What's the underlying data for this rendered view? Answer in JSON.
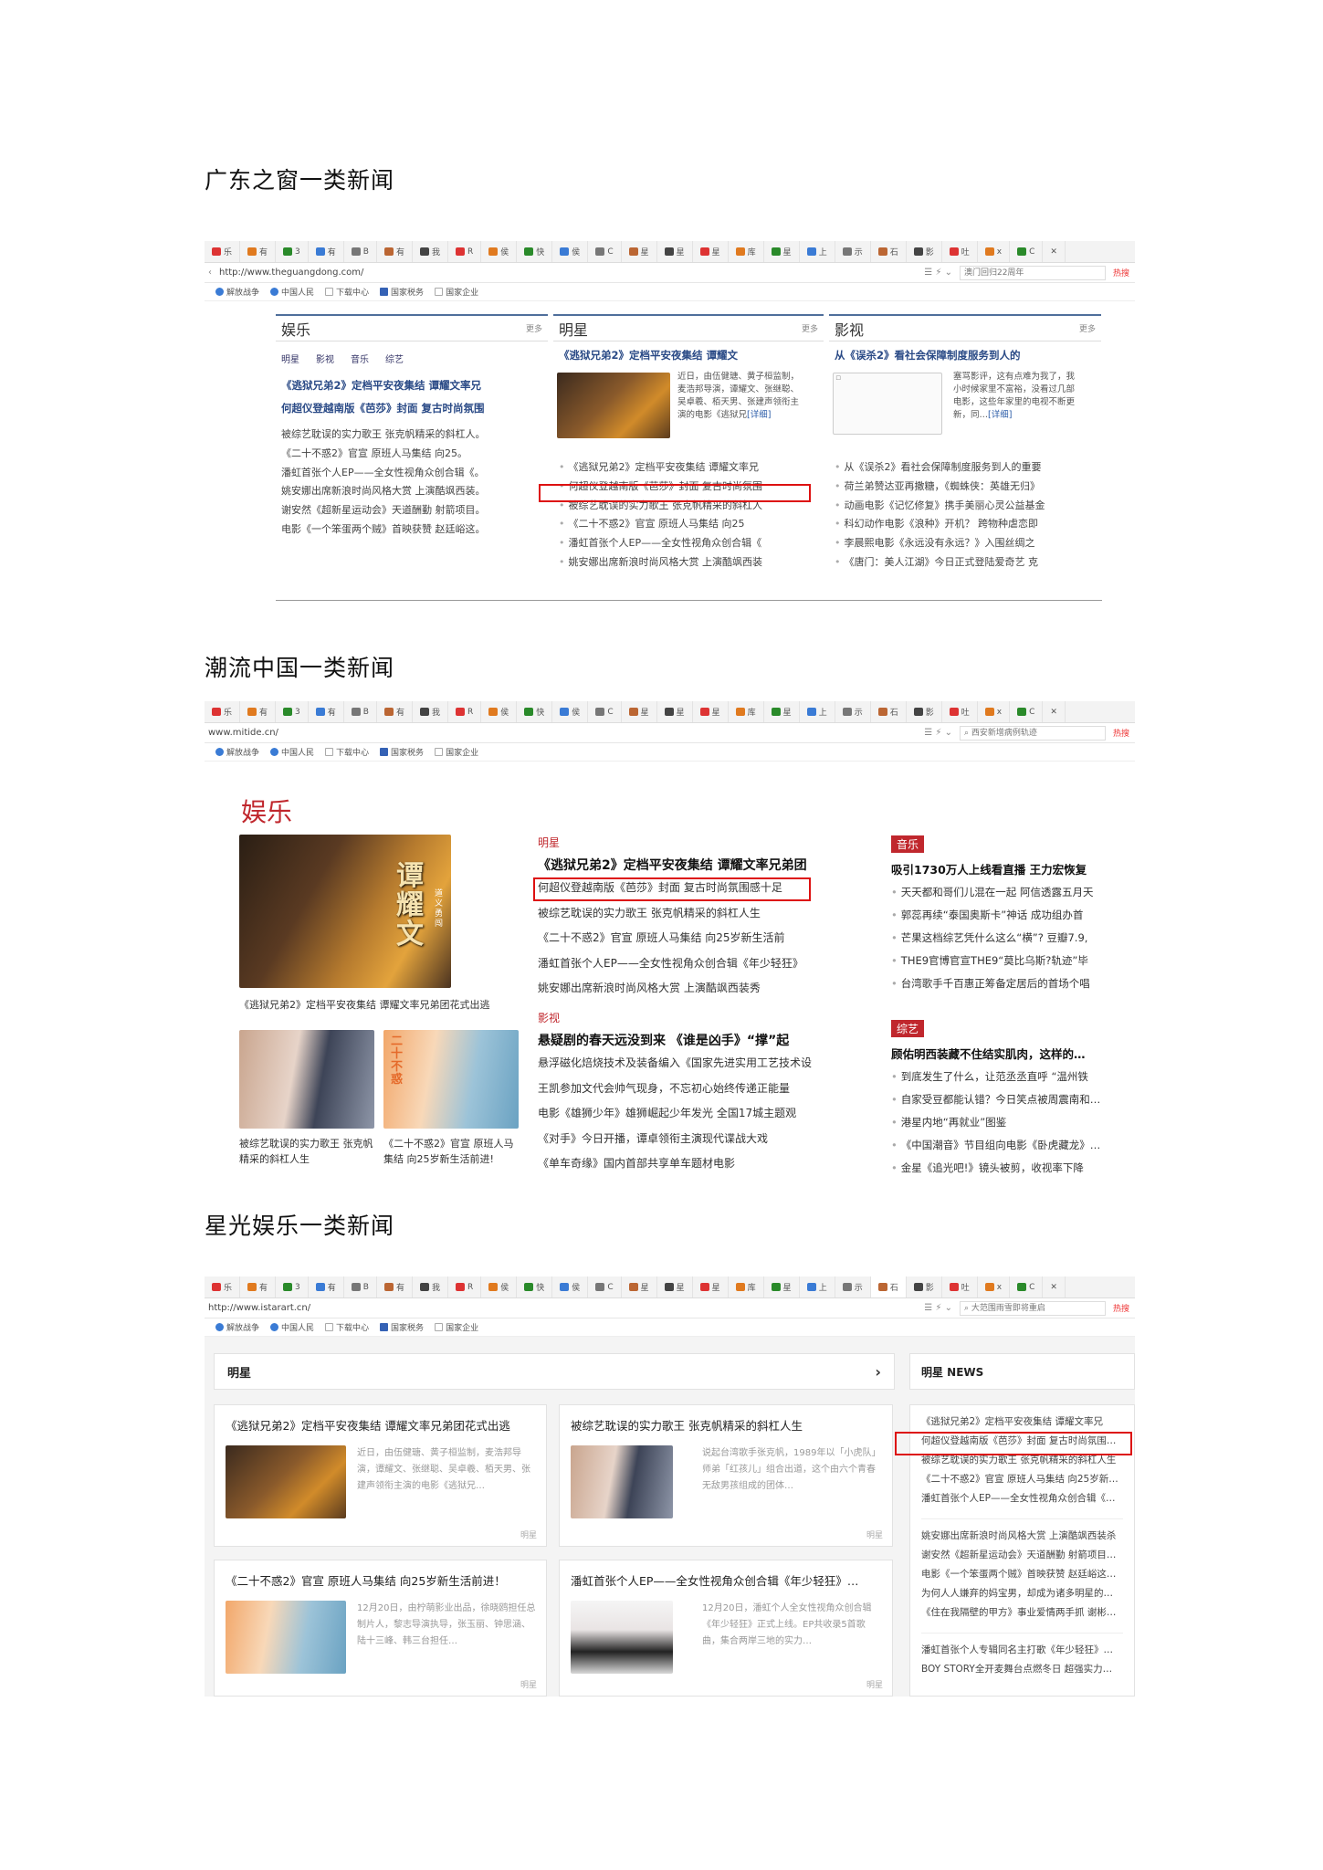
{
  "headings": {
    "s1": "广东之窗一类新闻",
    "s2": "潮流中国一类新闻",
    "s3": "星光娱乐一类新闻"
  },
  "browser": {
    "url1": "http://www.theguangdong.com/",
    "url2": "www.mitide.cn/",
    "url3": "http://www.istarart.cn/",
    "search1": "澳门回归22周年",
    "search2": "西安新增病例轨迹",
    "search3": "大范围雨雪即将重启",
    "hot": "热搜",
    "bookmarks": [
      "解放战争",
      "中国人民",
      "下载中心",
      "国家税务",
      "国家企业"
    ],
    "tabs": [
      "乐",
      "有",
      "3",
      "有",
      "B",
      "有",
      "我",
      "R",
      "侯",
      "快",
      "侯",
      "C",
      "星",
      "星",
      "星",
      "库",
      "星",
      "上",
      "示",
      "石",
      "影",
      "吐",
      "x",
      "C"
    ]
  },
  "s1": {
    "col1": {
      "title": "娱乐",
      "more": "更多",
      "subnav": [
        "明星",
        "影视",
        "音乐",
        "综艺"
      ],
      "bold": [
        "《逃狱兄弟2》定档平安夜集结 谭耀文率兄",
        "何超仪登越南版《芭莎》封面 复古时尚氛围"
      ],
      "items": [
        "被综艺耽误的实力歌王 张克帆精采的斜杠人。",
        "《二十不惑2》官宣 原班人马集结 向25。",
        "潘虹首张个人EP——全女性视角众创合辑《。",
        "姚安娜出席新浪时尚风格大赏 上演酷飒西装。",
        "谢安然《超新星运动会》天道酬勤 射箭项目。",
        "电影《一个笨蛋两个贼》首映获赞 赵廷峪这。"
      ]
    },
    "col2": {
      "title": "明星",
      "more": "更多",
      "bold": "《逃狱兄弟2》定档平安夜集结 谭耀文",
      "para": "近日，由伍健瑭、黄子桓监制，麦浩邦导演，谭耀文、张继聪、吴卓羲、栢天男、张建声领衔主演的电影《逃狱兄",
      "detail": "[详细]",
      "items": [
        "《逃狱兄弟2》定档平安夜集结 谭耀文率兄",
        "何超仪登越南版《芭莎》封面 复古时尚氛围",
        "被综艺耽误的实力歌王 张克帆精采的斜杠人",
        "《二十不惑2》官宣 原班人马集结 向25",
        "潘虹首张个人EP——全女性视角众创合辑《",
        "姚安娜出席新浪时尚风格大赏 上演酷飒西装"
      ]
    },
    "col3": {
      "title": "影视",
      "more": "更多",
      "bold": "从《误杀2》看社会保障制度服务到人的",
      "para": "塞骂影评，这有点难为我了，我小时候家里不富裕，没看过几部电影，这些年家里的电视不断更新，同…",
      "detail": "[详细]",
      "items": [
        "从《误杀2》看社会保障制度服务到人的重要",
        "荷兰弟赞达亚再撒糖，《蜘蛛侠：英雄无归》",
        "动画电影《记忆修复》携手美丽心灵公益基金",
        "科幻动作电影《浪种》开机？ 跨物种虐恋即",
        "李晨熙电影《永远没有永远？》入围丝绸之",
        "《唐门：美人江湖》今日正式登陆爱奇艺 克"
      ]
    }
  },
  "s2": {
    "section_title": "娱乐",
    "poster_text": "谭耀文",
    "poster_sub": "道义 勇闯",
    "hero_caption": "《逃狱兄弟2》定档平安夜集结 谭耀文率兄弟团花式出逃",
    "thumb1_caption": "被综艺耽误的实力歌王 张克帆精采的斜杠人生",
    "thumb2_caption": "《二十不惑2》官宣 原班人马集结 向25岁新生活前进!",
    "thumb2_logo": "二十不惑",
    "mid1": {
      "cat": "明星",
      "head": "《逃狱兄弟2》定档平安夜集结 谭耀文率兄弟团",
      "items": [
        "何超仪登越南版《芭莎》封面 复古时尚氛围感十足",
        "被综艺耽误的实力歌王 张克帆精采的斜杠人生",
        "《二十不惑2》官宣 原班人马集结 向25岁新生活前",
        "潘虹首张个人EP——全女性视角众创合辑《年少轻狂》",
        "姚安娜出席新浪时尚风格大赏 上演酷飒西装秀"
      ]
    },
    "mid2": {
      "cat": "影视",
      "head": "悬疑剧的春天远没到来 《谁是凶手》“撑”起",
      "items": [
        "悬浮磁化焙烧技术及装备编入《国家先进实用工艺技术设",
        "王凯参加文代会帅气现身，不忘初心始终传递正能量",
        "电影《雄狮少年》雄狮崛起少年发光 全国17城主题观",
        "《对手》今日开播，谭卓领衔主演现代谍战大戏",
        "《单车奇缘》国内首部共享单车题材电影"
      ]
    },
    "right1": {
      "cat": "音乐",
      "head": "吸引1730万人上线看直播 王力宏恢复",
      "items": [
        "天天都和哥们儿混在一起 阿信透露五月天",
        "郭蕊再续“泰国奥斯卡”神话 成功组办首",
        "芒果这档综艺凭什么这么“横”? 豆瓣7.9,",
        "THE9官博官宣THE9“莫比乌斯?轨迹”毕",
        "台湾歌手千百惠正筹备定居后的首场个唱"
      ]
    },
    "right2": {
      "cat": "综艺",
      "head": "顾佑明西装藏不住结实肌肉，这样的…",
      "items": [
        "到底发生了什么，让范丞丞直呼 “温州铁",
        "自家受豆都能认错？今日笑点被周震南和…",
        "港星内地“再就业”图鉴",
        "《中国潮音》节目组向电影《卧虎藏龙》…",
        "金星《追光吧!》镜头被剪，收视率下降"
      ]
    }
  },
  "s3": {
    "panel_title": "明星",
    "news_title": "明星 NEWS",
    "cards": [
      {
        "title": "《逃狱兄弟2》定档平安夜集结 谭耀文率兄弟团花式出逃",
        "desc": "近日，由伍健瑭、黄子桓监制，麦浩邦导演，谭耀文、张继聪、吴卓羲、栢天男、张建声领衔主演的电影《逃狱兄…",
        "tag": "明星"
      },
      {
        "title": "被综艺耽误的实力歌王 张克帆精采的斜杠人生",
        "desc": "说起台湾歌手张克帆，1989年以「小虎队」师弟「红孩儿」组合出道，这个由六个青春无敌男孩组成的团体…",
        "tag": "明星"
      },
      {
        "title": "《二十不惑2》官宣 原班人马集结 向25岁新生活前进！",
        "desc": "12月20日，由柠萌影业出品，徐晓鸥担任总制片人，黎志导演执导，张玉丽、钟思涵、陆十三峰、韩三台担任…",
        "tag": "明星"
      },
      {
        "title": "潘虹首张个人EP——全女性视角众创合辑《年少轻狂》…",
        "desc": "12月20日，潘虹个人全女性视角众创合辑《年少轻狂》正式上线。EP共收录5首歌曲，集合两岸三地的实力…",
        "tag": "明星"
      }
    ],
    "news": [
      "《逃狱兄弟2》定档平安夜集结 谭耀文率兄",
      "何超仪登越南版《芭莎》封面 复古时尚氛围…",
      "被综艺耽误的实力歌王 张克帆精采的斜杠人生",
      "《二十不惑2》官宣 原班人马集结 向25岁新…",
      "潘虹首张个人EP——全女性视角众创合辑《…",
      "姚安娜出席新浪时尚风格大赏 上演酷飒西装杀",
      "谢安然《超新星运动会》天道酬勤 射箭项目…",
      "电影《一个笨蛋两个贼》首映获赞 赵廷峪这…",
      "为何人人嫌弃的妈宝男，却成为诸多明星的…",
      "《住在我隔壁的甲方》事业爱情两手抓 谢彬…",
      "潘虹首张个人专辑同名主打歌《年少轻狂》…",
      "BOY STORY全开麦舞台点燃冬日 超强实力…"
    ]
  },
  "colors": {
    "red": "#c0272d",
    "box": "#dd1111",
    "navy": "#2a4a86"
  }
}
